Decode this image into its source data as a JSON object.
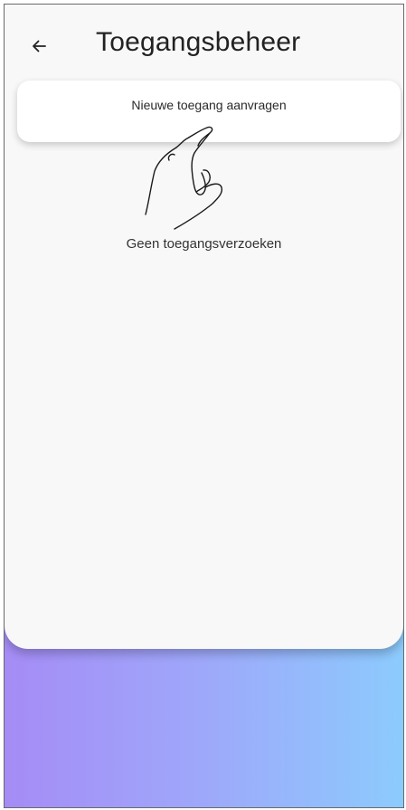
{
  "header": {
    "title": "Toegangsbeheer",
    "back_icon": "arrow-left-icon"
  },
  "main": {
    "request_button_label": "Nieuwe toegang aanvragen",
    "empty_state_text": "Geen toegangsverzoeken",
    "tap_hint_icon": "pointing-hand-icon"
  },
  "colors": {
    "sheet_background": "#f8f8f8",
    "card_background": "#ffffff",
    "gradient_start": "#a58cf6",
    "gradient_end": "#8ccbfd",
    "text": "#222222"
  }
}
